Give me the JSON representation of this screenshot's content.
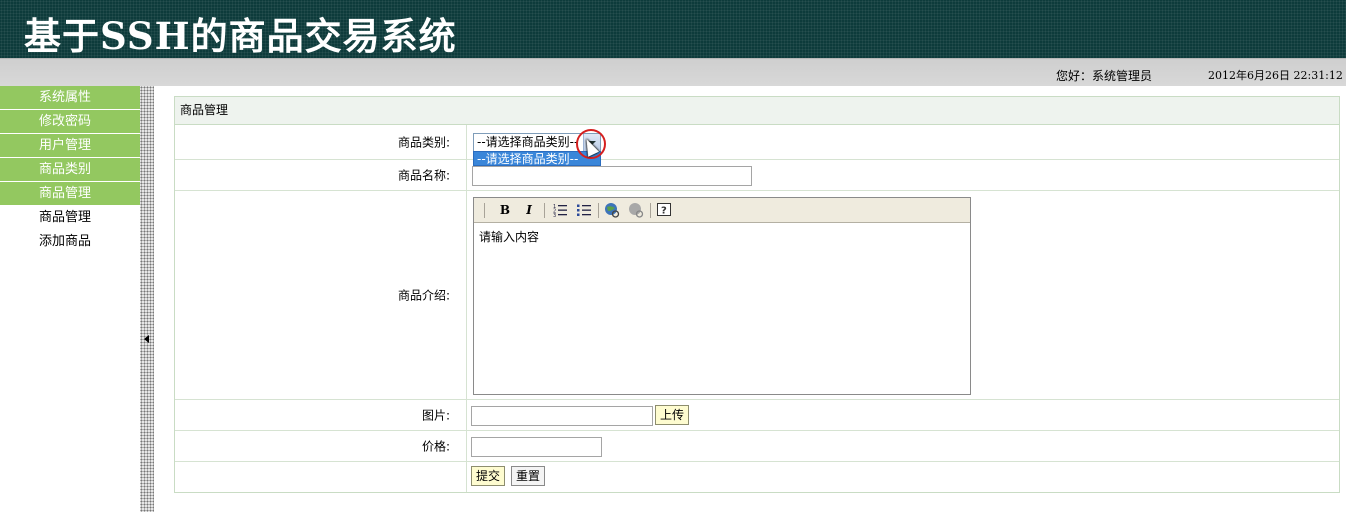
{
  "header": {
    "title": "基于SSH的商品交易系统"
  },
  "infobar": {
    "greeting": "您好：系统管理员",
    "datetime": "2012年6月26日  22:31:12"
  },
  "sidebar": {
    "groups": [
      "系统属性",
      "修改密码",
      "用户管理",
      "商品类别",
      "商品管理"
    ],
    "sub_items": [
      "商品管理",
      "添加商品"
    ]
  },
  "panel": {
    "title": "商品管理"
  },
  "form": {
    "category": {
      "label": "商品类别:",
      "selected": "--请选择商品类别--",
      "option": "--请选择商品类别--"
    },
    "name": {
      "label": "商品名称:",
      "value": ""
    },
    "intro": {
      "label": "商品介绍:",
      "content": "请输入内容"
    },
    "image": {
      "label": "图片:",
      "value": "",
      "upload_label": "上传"
    },
    "price": {
      "label": "价格:",
      "value": ""
    },
    "submit_label": "提交",
    "reset_label": "重置"
  },
  "editor_toolbar": [
    "bold-icon",
    "italic-icon",
    "ordered-list-icon",
    "unordered-list-icon",
    "link-icon",
    "unlink-icon",
    "help-icon"
  ],
  "colors": {
    "header_bg": "#0d3b3b",
    "menu_green": "#93c860",
    "dropdown_highlight": "#3a86d9"
  }
}
